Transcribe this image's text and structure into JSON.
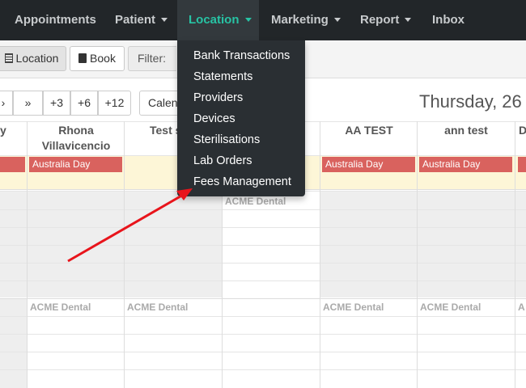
{
  "nav": {
    "items": [
      {
        "label": "Appointments",
        "has_caret": false
      },
      {
        "label": "Patient",
        "has_caret": true
      },
      {
        "label": "Location",
        "has_caret": true,
        "active": true
      },
      {
        "label": "Marketing",
        "has_caret": true
      },
      {
        "label": "Report",
        "has_caret": true
      },
      {
        "label": "Inbox",
        "has_caret": false
      }
    ]
  },
  "location_menu": {
    "items": [
      "Bank Transactions",
      "Statements",
      "Providers",
      "Devices",
      "Sterilisations",
      "Lab Orders",
      "Fees Management"
    ]
  },
  "toolbar": {
    "appointment_label": "Location",
    "book_label": "Book",
    "filter_label": "Filter:"
  },
  "date_nav": {
    "buttons": [
      "»",
      "+3",
      "+6",
      "+12"
    ],
    "calendar_label": "Calen",
    "date_title": "Thursday, 26"
  },
  "calendar": {
    "columns": [
      {
        "header": "y"
      },
      {
        "header": "Rhona Villavicencio",
        "line1": "Rhona",
        "line2": "Villavicencio"
      },
      {
        "header": "Test s"
      },
      {
        "header": "]"
      },
      {
        "header": "AA TEST"
      },
      {
        "header": "ann test"
      },
      {
        "header": "D"
      }
    ],
    "holiday_label": "Australia Day",
    "clinic_label": "ACME Dental"
  },
  "colors": {
    "navbar": "#222629",
    "accent": "#27c3a4",
    "holiday": "#d9625e",
    "arrow": "#e8141b"
  }
}
